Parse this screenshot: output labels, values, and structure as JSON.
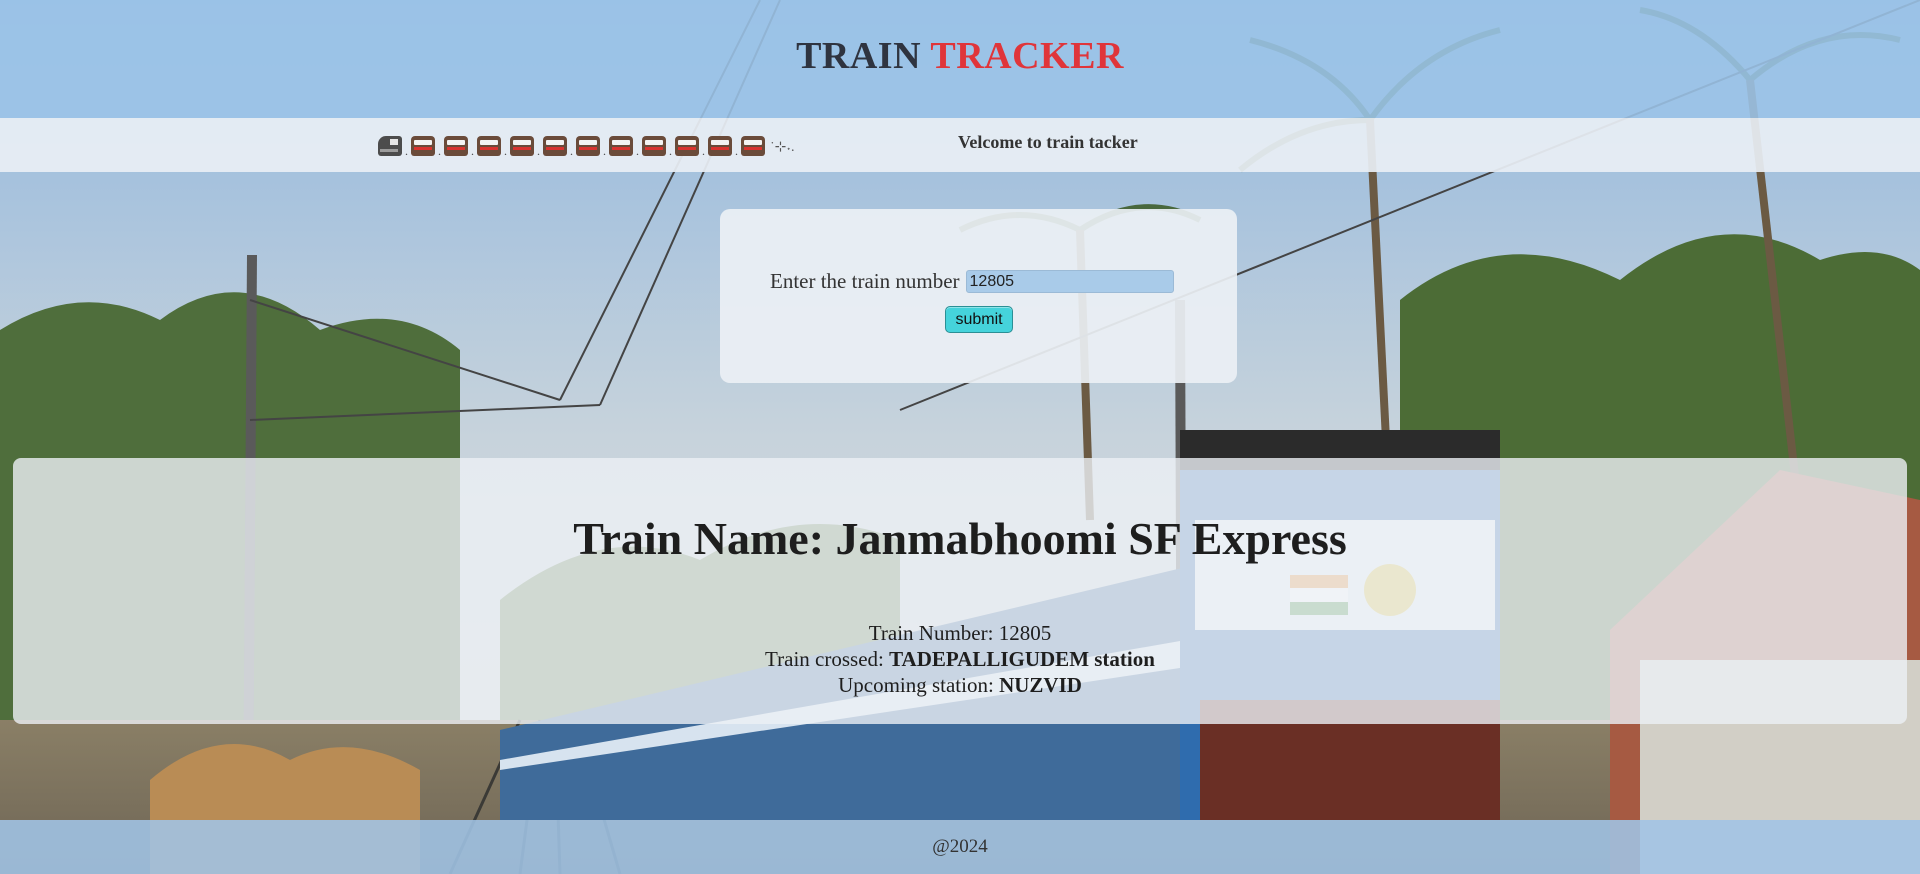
{
  "header": {
    "title_part1": "TRAIN",
    "title_part2": "TRACKER",
    "accent_color": "#e0353a"
  },
  "marquee": {
    "sparkle": "˙⊹˖.",
    "welcome_text": "Velcome to train tacker"
  },
  "form": {
    "label": "Enter the train number",
    "input_value": "12805",
    "submit_label": "submit"
  },
  "result": {
    "name_label": "Train Name:",
    "name_value": "Janmabhoomi SF Express",
    "number_label": "Train Number:",
    "number_value": "12805",
    "crossed_label": "Train crossed:",
    "crossed_value": "TADEPALLIGUDEM station",
    "upcoming_label": "Upcoming station:",
    "upcoming_value": "NUZVID"
  },
  "footer": {
    "text": "@2024"
  }
}
